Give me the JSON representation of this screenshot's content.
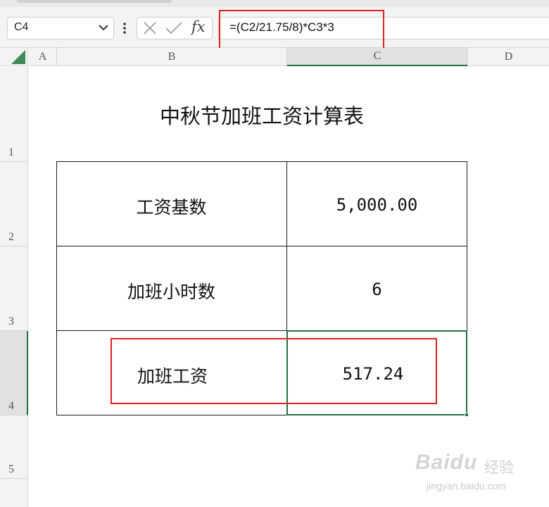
{
  "formula_bar": {
    "name_box": "C4",
    "formula": "=(C2/21.75/8)*C3*3",
    "fx_label": "fx"
  },
  "columns": [
    "A",
    "B",
    "C",
    "D"
  ],
  "rows": [
    "1",
    "2",
    "3",
    "4",
    "5"
  ],
  "sheet": {
    "title": "中秋节加班工资计算表",
    "table": [
      {
        "label": "工资基数",
        "value": "5,000.00"
      },
      {
        "label": "加班小时数",
        "value": "6"
      },
      {
        "label": "加班工资",
        "value": "517.24"
      }
    ]
  },
  "selection": {
    "cell": "C4",
    "color": "#217346"
  },
  "highlight_color": "#e02020",
  "watermark": {
    "brand": "Baidu",
    "brand_cn": "经验",
    "url": "jingyan.baidu.com"
  }
}
